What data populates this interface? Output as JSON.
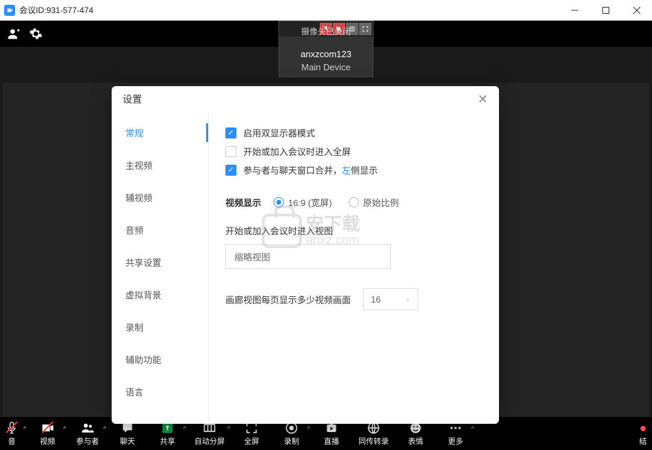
{
  "titlebar": {
    "title": "会议ID:931-577-474"
  },
  "video_tile": {
    "status": "摄像头已关闭",
    "name": "anxzcom123",
    "device": "Main Device"
  },
  "modal": {
    "title": "设置",
    "sidebar": {
      "items": [
        {
          "label": "常规",
          "active": true
        },
        {
          "label": "主视频"
        },
        {
          "label": "辅视频"
        },
        {
          "label": "音频"
        },
        {
          "label": "共享设置"
        },
        {
          "label": "虚拟背景"
        },
        {
          "label": "录制"
        },
        {
          "label": "辅助功能"
        },
        {
          "label": "语言"
        }
      ]
    },
    "content": {
      "check1": {
        "label": "启用双显示器模式",
        "checked": true
      },
      "check2": {
        "label": "开始或加入会议时进入全屏",
        "checked": false
      },
      "check3": {
        "label_a": "参与者与聊天窗口合并，",
        "label_b": "左",
        "label_c": "侧显示",
        "checked": true
      },
      "video_display_label": "视频显示",
      "radio1": "16:9 (宽屏)",
      "radio2": "原始比例",
      "enter_view_label": "开始或加入会议时进入视图",
      "enter_view_value": "缩略视图",
      "gallery_label": "画廊视图每页显示多少视频画面",
      "gallery_value": "16"
    }
  },
  "bottom_toolbar": {
    "items": [
      {
        "label": "音"
      },
      {
        "label": "视频"
      },
      {
        "label": "参与者"
      },
      {
        "label": "聊天"
      },
      {
        "label": "共享"
      },
      {
        "label": "自动分屏"
      },
      {
        "label": "全屏"
      },
      {
        "label": "录制"
      },
      {
        "label": "直播"
      },
      {
        "label": "同传转录"
      },
      {
        "label": "表情"
      },
      {
        "label": "更多"
      },
      {
        "label": "结"
      }
    ]
  },
  "watermark": {
    "line1": "安下载",
    "line2": "anxz.com"
  }
}
